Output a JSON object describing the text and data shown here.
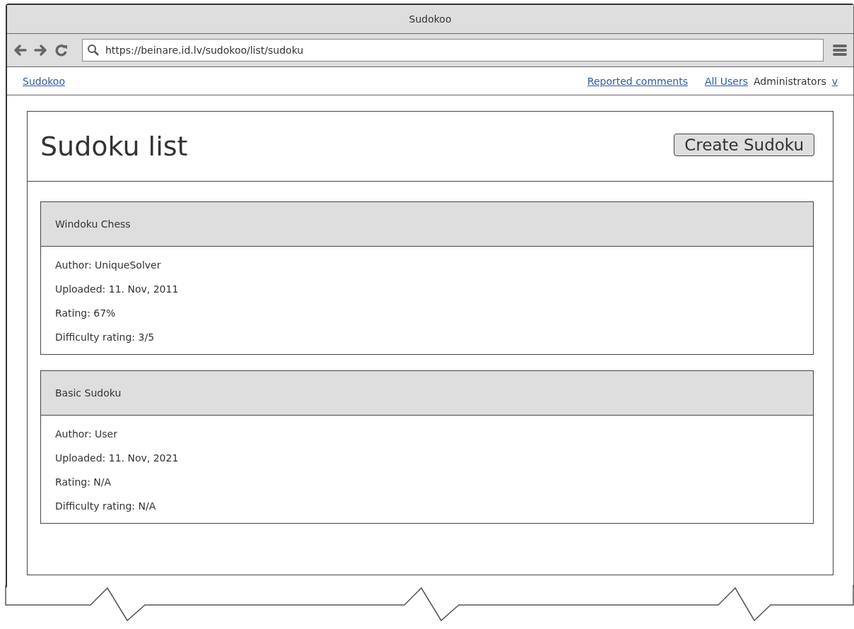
{
  "window": {
    "title": "Sudokoo"
  },
  "browser": {
    "url": "https://beinare.id.lv/sudokoo/list/sudoku"
  },
  "nav": {
    "brand": "Sudokoo",
    "links": [
      "Reported comments",
      "All Users"
    ],
    "user_menu": {
      "label": "Administrators",
      "caret": "v"
    }
  },
  "page": {
    "title": "Sudoku list",
    "create_button": "Create Sudoku"
  },
  "sudokus": [
    {
      "name": "Windoku Chess",
      "details": [
        "Author: UniqueSolver",
        "Uploaded: 11. Nov, 2011",
        "Rating: 67%",
        "Difficulty rating: 3/5"
      ]
    },
    {
      "name": "Basic Sudoku",
      "details": [
        "Author: User",
        "Uploaded: 11. Nov, 2021",
        "Rating: N/A",
        "Difficulty rating: N/A"
      ]
    }
  ]
}
